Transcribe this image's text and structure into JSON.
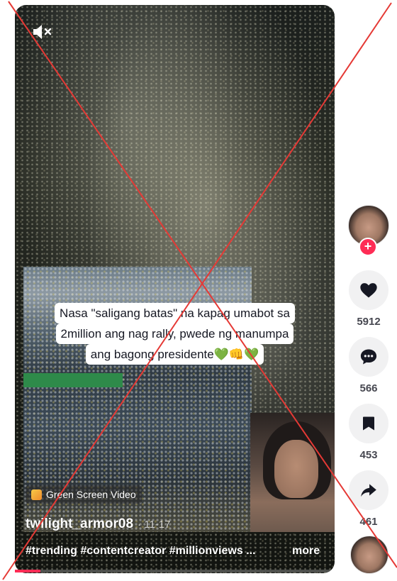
{
  "video": {
    "caption_lines": [
      "Nasa \"saligang batas\" na kapag umabot sa",
      "2million ang nag rally, pwede ng manumpa",
      "ang bagong presidente💚👊💚"
    ],
    "badge_label": "Green Screen Video",
    "author": "twilight_armor08",
    "date": "· 11-17",
    "hashtags": "#trending #contentcreator #millionviews ...",
    "more_label": "more",
    "progress": 0.08
  },
  "sidebar": {
    "follow_label": "+",
    "likes": "5912",
    "comments": "566",
    "saves": "453",
    "shares": "461"
  },
  "icons": {
    "mute": "mute-icon",
    "heart": "heart-icon",
    "comment": "comment-icon",
    "bookmark": "bookmark-icon",
    "share": "share-icon"
  },
  "colors": {
    "accent": "#fe2c55",
    "overlay_lines": "#e53935",
    "action_bg": "#f1f1f2"
  }
}
